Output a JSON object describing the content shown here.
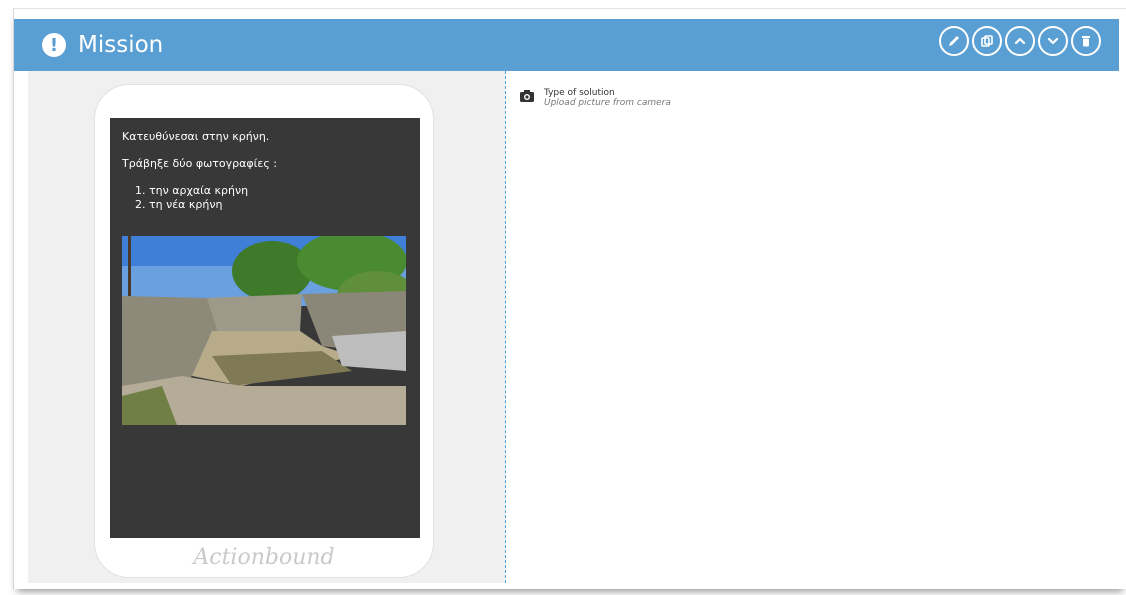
{
  "mission": {
    "title": "Mission",
    "actions": [
      {
        "icon": "edit-icon"
      },
      {
        "icon": "duplicate-icon"
      },
      {
        "icon": "move-up-icon"
      },
      {
        "icon": "move-down-icon"
      },
      {
        "icon": "delete-icon"
      }
    ]
  },
  "preview": {
    "intro": "Κατευθύνεσαι στην κρήνη.",
    "instruction": "Τράβηξε δύο φωτογραφίες :",
    "items": [
      "την αρχαία κρήνη",
      "τη νέα κρήνη"
    ],
    "brand": "Actionbound"
  },
  "solution": {
    "label": "Type of solution",
    "value": "Upload picture from camera"
  },
  "colors": {
    "header": "#5a9fd3",
    "divider": "#4aa0d8",
    "screen": "#383838"
  }
}
